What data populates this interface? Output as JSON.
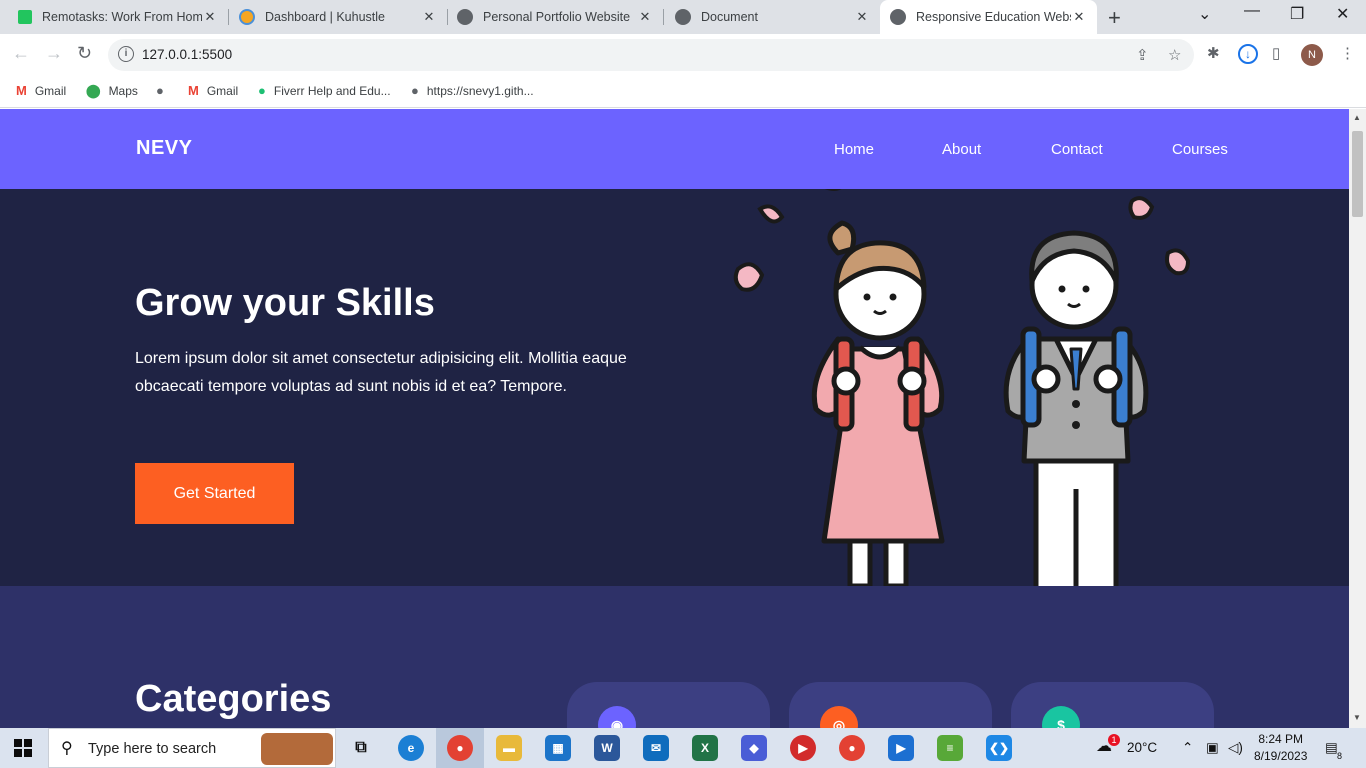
{
  "browser": {
    "tabs": [
      {
        "title": "Remotasks: Work From Home",
        "icon": "remotasks-icon",
        "color": "#22c55e"
      },
      {
        "title": "Dashboard | Kuhustle",
        "icon": "kuhustle-icon",
        "color": "#f5a623"
      },
      {
        "title": "Personal Portfolio Website",
        "icon": "globe-icon",
        "color": "#5f6368"
      },
      {
        "title": "Document",
        "icon": "globe-icon",
        "color": "#5f6368"
      },
      {
        "title": "Responsive Education Website",
        "icon": "globe-icon",
        "color": "#5f6368"
      }
    ],
    "new_tab": "+",
    "url": "127.0.0.1:5500",
    "profile_initial": "N",
    "bookmarks": [
      {
        "label": "Gmail",
        "icon": "gmail-icon"
      },
      {
        "label": "Maps",
        "icon": "maps-icon"
      },
      {
        "label": "",
        "icon": "globe-icon"
      },
      {
        "label": "Gmail",
        "icon": "gmail-icon"
      },
      {
        "label": "Fiverr Help and Edu...",
        "icon": "fiverr-icon"
      },
      {
        "label": "https://snevy1.gith...",
        "icon": "globe-icon"
      }
    ]
  },
  "site": {
    "logo": "NEVY",
    "nav": [
      "Home",
      "About",
      "Contact",
      "Courses"
    ],
    "hero": {
      "title": "Grow your Skills",
      "text": "Lorem ipsum dolor sit amet consectetur adipisicing elit. Mollitia eaque obcaecati tempore voluptas ad sunt nobis id et ea? Tempore.",
      "cta": "Get Started"
    },
    "categories": {
      "title": "Categories",
      "cards": [
        {
          "icon": "design-icon",
          "color": "#6c63ff"
        },
        {
          "icon": "dribbble-icon",
          "color": "#fd5f22"
        },
        {
          "icon": "dollar-icon",
          "color": "#19c5a1"
        }
      ]
    },
    "colors": {
      "nav": "#6c63ff",
      "hero": "#1f2344",
      "accent": "#fd5f22",
      "section": "#2e3168"
    }
  },
  "taskbar": {
    "search_placeholder": "Type here to search",
    "weather": "20°C",
    "time": "8:24 PM",
    "date": "8/19/2023",
    "notifications": "8",
    "weather_badge": "1"
  }
}
